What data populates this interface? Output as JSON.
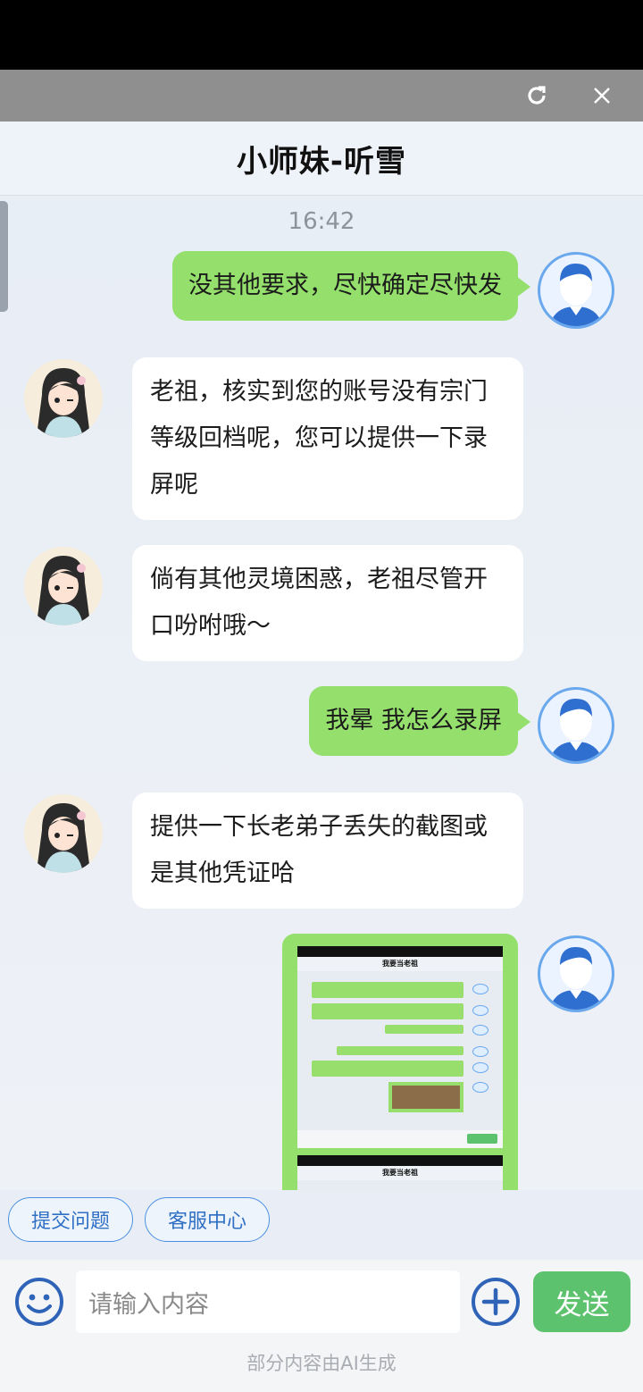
{
  "window": {
    "refresh_icon": "refresh-icon",
    "close_icon": "close-icon"
  },
  "header": {
    "title": "小师妹-听雪"
  },
  "chat": {
    "time": "16:42",
    "messages": [
      {
        "from": "user",
        "text": "没其他要求，尽快确定尽快发"
      },
      {
        "from": "bot",
        "text": "老祖，核实到您的账号没有宗门等级回档呢，您可以提供一下录屏呢"
      },
      {
        "from": "bot",
        "text": "倘有其他灵境困惑，老祖尽管开口吩咐哦～"
      },
      {
        "from": "user",
        "text": "我晕 我怎么录屏"
      },
      {
        "from": "bot",
        "text": "提供一下长老弟子丢失的截图或是其他凭证哈"
      },
      {
        "from": "user",
        "type": "image",
        "image_title": "我要当老祖"
      }
    ]
  },
  "quick_actions": [
    {
      "label": "提交问题"
    },
    {
      "label": "客服中心"
    }
  ],
  "composer": {
    "placeholder": "请输入内容",
    "send_label": "发送",
    "emoji_icon": "smiley-icon",
    "plus_icon": "plus-circle-icon"
  },
  "footer": {
    "note": "部分内容由AI生成"
  },
  "colors": {
    "user_bubble": "#95e06c",
    "bot_bubble": "#ffffff",
    "send": "#5cc26d",
    "accent": "#4a90e2"
  }
}
